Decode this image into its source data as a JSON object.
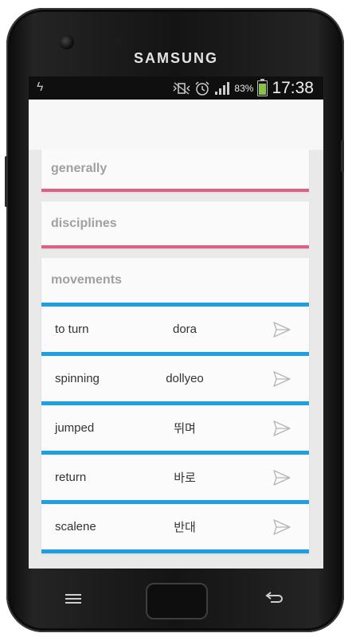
{
  "device": {
    "brand": "SAMSUNG"
  },
  "statusbar": {
    "left_icon": "usb-debug-icon",
    "battery_percent": "83%",
    "battery_level": 0.83,
    "time": "17:38",
    "icons": [
      "vibrate-icon",
      "alarm-icon",
      "signal-icon",
      "battery-icon"
    ]
  },
  "categories": [
    {
      "title": "generally",
      "accent": "#e06085"
    },
    {
      "title": "disciplines",
      "accent": "#e06085"
    },
    {
      "title": "movements",
      "accent": "#1e9fe0"
    }
  ],
  "phrases": [
    {
      "en": "to turn",
      "ko": "dora"
    },
    {
      "en": "spinning",
      "ko": "dollyeo"
    },
    {
      "en": "jumped",
      "ko": "뛰며"
    },
    {
      "en": "return",
      "ko": "바로"
    },
    {
      "en": "scalene",
      "ko": "반대"
    }
  ]
}
